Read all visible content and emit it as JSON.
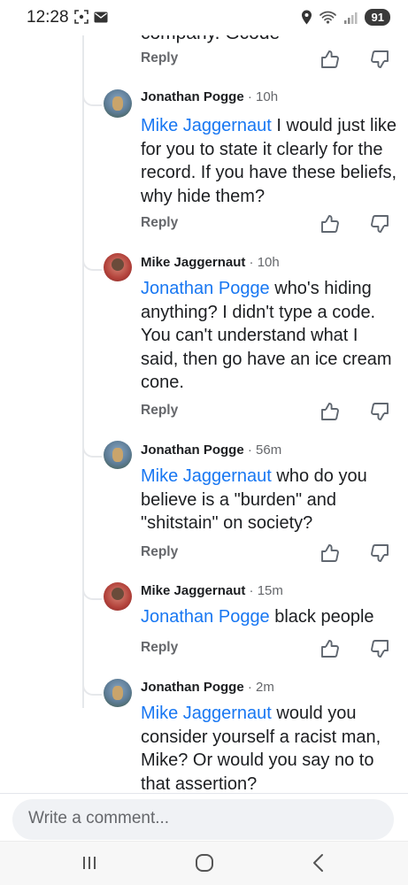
{
  "status_bar": {
    "time": "12:28",
    "battery": "91",
    "icons": [
      "screenshot-icon",
      "mail-icon",
      "location-icon",
      "wifi-icon",
      "signal-icon",
      "battery-icon"
    ]
  },
  "partial_comment_text": "company. Gcode",
  "reply_label": "Reply",
  "comments": [
    {
      "author": "Jonathan Pogge",
      "time": "· 10h",
      "mention": "Mike Jaggernaut",
      "text": " I would just like for you to state it clearly for the record. If you have these beliefs, why hide them?"
    },
    {
      "author": "Mike Jaggernaut",
      "time": "· 10h",
      "mention": "Jonathan Pogge",
      "text": " who's hiding anything? I didn't type a code. You can't understand what I said, then go have an ice cream cone."
    },
    {
      "author": "Jonathan Pogge",
      "time": "· 56m",
      "mention": "Mike Jaggernaut",
      "text": " who do you believe is a \"burden\" and \"shitstain\" on society?"
    },
    {
      "author": "Mike Jaggernaut",
      "time": "· 15m",
      "mention": "Jonathan Pogge",
      "text": " black people"
    },
    {
      "author": "Jonathan Pogge",
      "time": "· 2m",
      "mention": "Mike Jaggernaut",
      "text": " would you consider yourself a racist man, Mike? Or would you say no to that assertion?"
    }
  ],
  "composer": {
    "placeholder": "Write a comment..."
  },
  "colors": {
    "mention": "#1877f2",
    "secondary_text": "#65676b"
  }
}
